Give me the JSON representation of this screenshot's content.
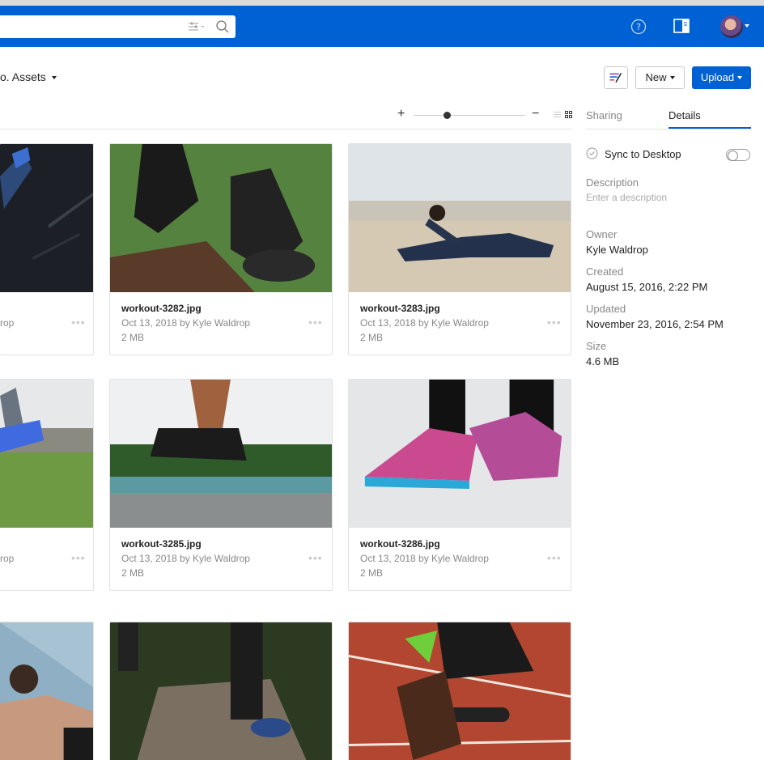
{
  "header": {
    "search_placeholder": "",
    "icons": [
      "filter-icon",
      "search-icon",
      "help-icon",
      "sidebar-toggle-icon",
      "avatar"
    ],
    "brand_color": "#0061d5"
  },
  "breadcrumb": {
    "label": "o. Assets"
  },
  "toolbar": {
    "new_label": "New",
    "upload_label": "Upload",
    "zoom_plus": "+",
    "zoom_minus": "−"
  },
  "sidebar": {
    "tabs": [
      {
        "label": "Sharing",
        "active": false
      },
      {
        "label": "Details",
        "active": true
      }
    ],
    "sync_label": "Sync to Desktop",
    "sync_enabled": false,
    "description_label": "Description",
    "description_placeholder": "Enter a description",
    "owner_label": "Owner",
    "owner_value": "Kyle Waldrop",
    "created_label": "Created",
    "created_value": "August 15, 2016, 2:22 PM",
    "updated_label": "Updated",
    "updated_value": "November 23, 2016, 2:54 PM",
    "size_label": "Size",
    "size_value": "4.6 MB"
  },
  "files": [
    {
      "name": "",
      "meta": "rop",
      "size": ""
    },
    {
      "name": "workout-3282.jpg",
      "meta": "Oct 13, 2018 by Kyle Waldrop",
      "size": "2 MB"
    },
    {
      "name": "workout-3283.jpg",
      "meta": "Oct 13, 2018 by Kyle Waldrop",
      "size": "2 MB"
    },
    {
      "name": "",
      "meta": "rop",
      "size": ""
    },
    {
      "name": "workout-3285.jpg",
      "meta": "Oct 13, 2018 by Kyle Waldrop",
      "size": "2 MB"
    },
    {
      "name": "workout-3286.jpg",
      "meta": "Oct 13, 2018 by Kyle Waldrop",
      "size": "2 MB"
    }
  ],
  "more_label": "•••"
}
